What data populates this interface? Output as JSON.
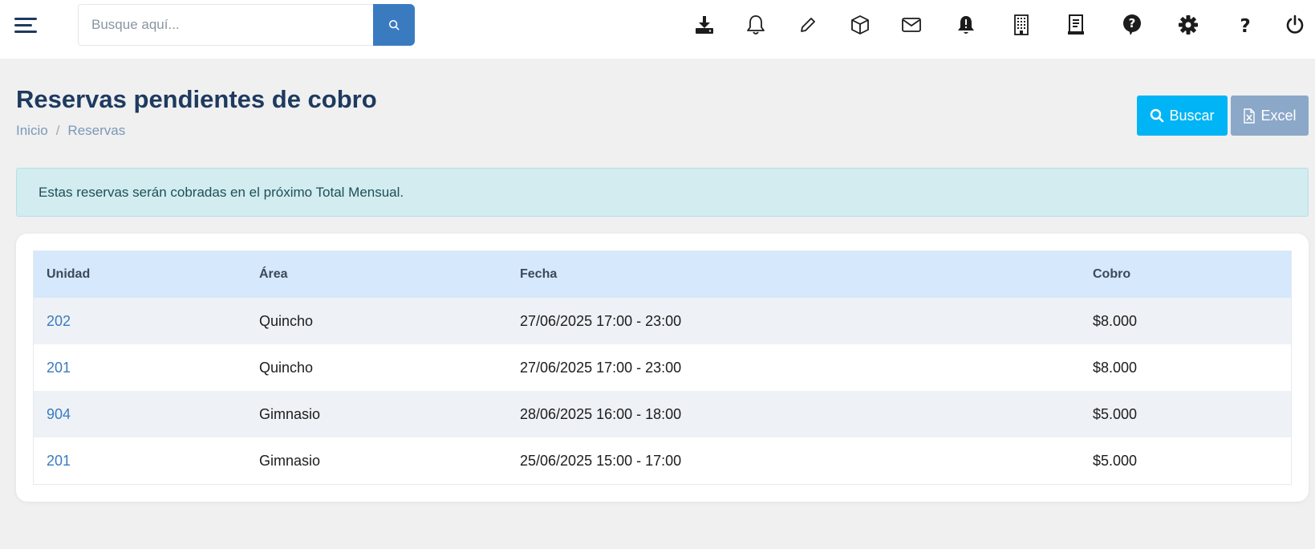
{
  "colors": {
    "brand_dark": "#1e3a5f",
    "search_button": "#3a7bc0",
    "buscar_button": "#00b4f5",
    "excel_button": "#8ba8c8",
    "alert_bg": "#d2ecef",
    "table_header_bg": "#d6e8fb",
    "link": "#3a7bc0"
  },
  "topbar": {
    "menu_icon": "hamburger-menu-icon",
    "search": {
      "placeholder": "Busque aquí...",
      "value": "",
      "button_icon": "search-icon"
    },
    "icons": [
      "download-tray-icon",
      "bell-outline-icon",
      "pencil-icon",
      "package-box-icon",
      "envelope-icon",
      "bell-alert-icon",
      "building-icon",
      "receipt-icon",
      "help-chat-icon",
      "gear-icon",
      "question-mark-icon",
      "power-icon"
    ]
  },
  "header": {
    "title": "Reservas pendientes de cobro",
    "breadcrumb": [
      "Inicio",
      "Reservas"
    ],
    "breadcrumb_separator": "/",
    "buttons": {
      "buscar": {
        "label": "Buscar",
        "icon": "search-icon"
      },
      "excel": {
        "label": "Excel",
        "icon": "excel-file-icon"
      }
    }
  },
  "alert": {
    "text": "Estas reservas serán cobradas en el próximo Total Mensual."
  },
  "table": {
    "columns": [
      "Unidad",
      "Área",
      "Fecha",
      "Cobro"
    ],
    "rows": [
      {
        "unidad": "202",
        "area": "Quincho",
        "fecha": "27/06/2025 17:00 - 23:00",
        "cobro": "$8.000"
      },
      {
        "unidad": "201",
        "area": "Quincho",
        "fecha": "27/06/2025 17:00 - 23:00",
        "cobro": "$8.000"
      },
      {
        "unidad": "904",
        "area": "Gimnasio",
        "fecha": "28/06/2025 16:00 - 18:00",
        "cobro": "$5.000"
      },
      {
        "unidad": "201",
        "area": "Gimnasio",
        "fecha": "25/06/2025 15:00 - 17:00",
        "cobro": "$5.000"
      }
    ]
  }
}
